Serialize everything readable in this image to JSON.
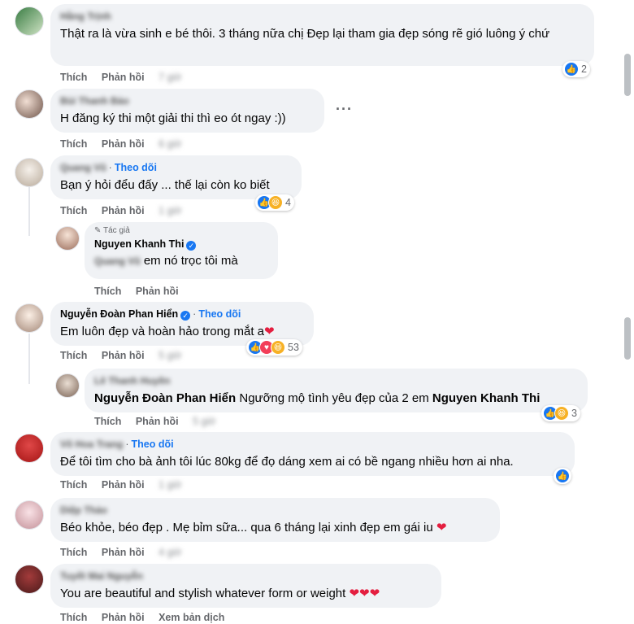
{
  "actions": {
    "like": "Thích",
    "reply": "Phản hồi",
    "translate": "Xem bản dịch"
  },
  "follow_label": "Theo dõi",
  "author_tag": "Tác giả",
  "comments": [
    {
      "name": "Hằng Trịnh",
      "text": "Thật ra là vừa sinh e bé thôi. 3 tháng nữa chị Đẹp lại tham gia đẹp sóng rẽ gió luông ý chứ",
      "time": "7 giờ",
      "reactions": "2"
    },
    {
      "name": "Bùi Thanh Bảo",
      "text": "H đăng ký thi một giải thi thì eo ót ngay :))",
      "time": "6 giờ"
    },
    {
      "name": "Quang Vũ",
      "text": "Bạn ý hỏi đểu đấy ... thế lại còn ko biết",
      "time": "1 giờ",
      "reactions": "4"
    },
    {
      "name": "Nguyen Khanh Thi",
      "mention": "Quang Vũ",
      "text": "em nó trọc tôi mà",
      "time": ""
    },
    {
      "name": "Nguyễn Đoàn Phan Hiển",
      "text": "Em luôn đẹp và hoàn hảo trong mắt a",
      "time": "5 giờ",
      "reactions": "53"
    },
    {
      "name": "Lê Thanh Huyền",
      "mention": "Nguyễn Đoàn Phan Hiển",
      "text": "Ngưỡng mộ tình yêu đẹp của 2 em",
      "mention2": "Nguyen Khanh Thi",
      "time": "5 giờ",
      "reactions": "3"
    },
    {
      "name": "Võ Hoa Trang",
      "text": "Để tôi tìm cho bà ảnh tôi lúc 80kg để đọ dáng xem ai có bề ngang nhiều hơn ai nha.",
      "time": "1 giờ"
    },
    {
      "name": "Diệp Thảo",
      "text": "Béo khỏe, béo đẹp . Mẹ bỉm sữa... qua 6 tháng lại xinh đẹp em gái iu",
      "time": "4 giờ"
    },
    {
      "name": "Tuyết Mai Nguyễn",
      "text": "You are beautiful and stylish whatever form or weight",
      "time": ""
    }
  ],
  "colors": {
    "accent": "#1877f2",
    "bubble": "#f0f2f5",
    "muted": "#65676b",
    "heart": "#e41e3f"
  }
}
